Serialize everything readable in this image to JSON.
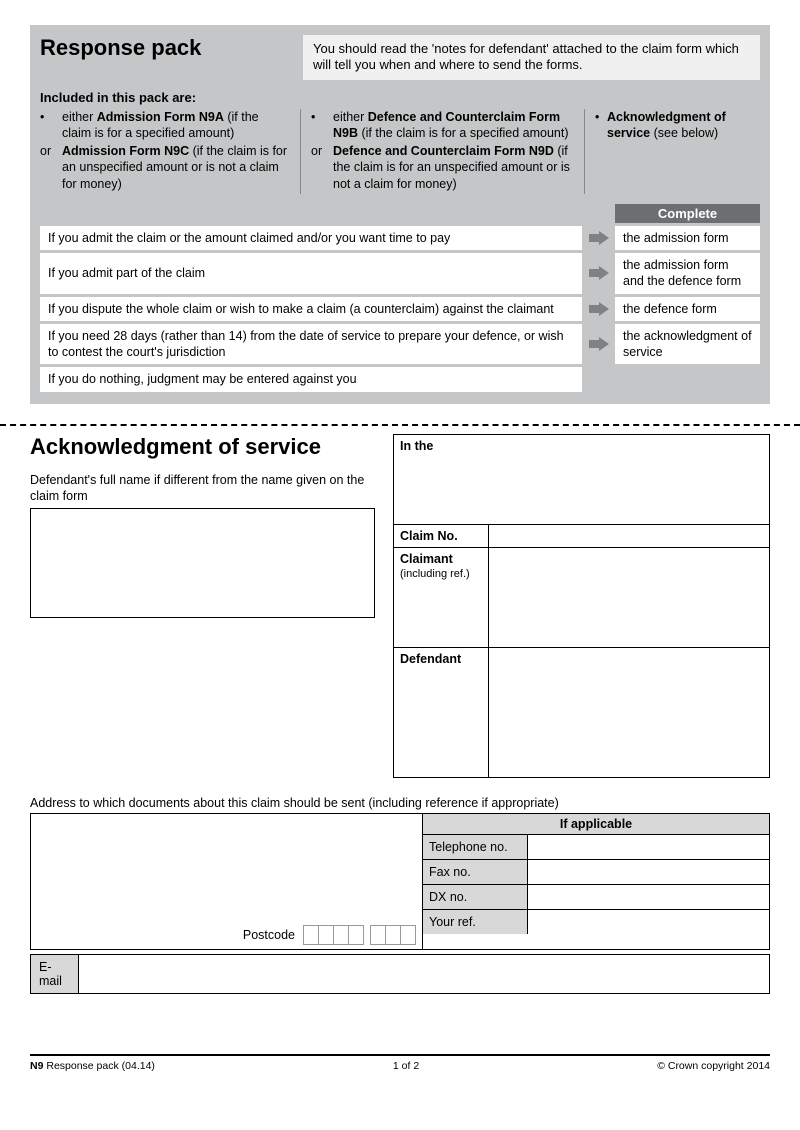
{
  "header": {
    "title": "Response pack",
    "notice": "You should read the 'notes for defendant' attached to the claim form which will tell you when and where to send the forms."
  },
  "included": {
    "heading": "Included in this pack are:",
    "col1": {
      "r1_bullet": "•",
      "r1_pre": "either ",
      "r1_bold": "Admission Form N9A",
      "r1_post": " (if the claim is for a specified amount)",
      "r2_bullet": "or",
      "r2_bold": "Admission Form N9C",
      "r2_post": " (if the claim is for an unspecified amount or is not a claim for money)"
    },
    "col2": {
      "r1_bullet": "•",
      "r1_pre": "either ",
      "r1_bold": "Defence and Counterclaim Form N9B",
      "r1_post": " (if the claim is for a specified amount)",
      "r2_bullet": "or",
      "r2_bold": "Defence and Counterclaim Form N9D",
      "r2_post": " (if the claim is for an unspecified amount or is not a claim for money)"
    },
    "col3": {
      "bullet": "•",
      "bold": "Acknowledgment of service",
      "post": " (see below)"
    }
  },
  "complete_label": "Complete",
  "rows": [
    {
      "left": "If you admit the claim or the amount claimed and/or you want time to pay",
      "right": "the admission form"
    },
    {
      "left": "If you admit part of the claim",
      "right": "the admission form and the defence form"
    },
    {
      "left": "If you dispute the whole claim or wish to make a claim (a counterclaim) against the claimant",
      "right": "the defence form"
    },
    {
      "left": "If you need 28 days (rather than 14) from the date of service to prepare your defence, or wish to contest the court's jurisdiction",
      "right": "the acknowledgment of service"
    }
  ],
  "nothing_row": "If you do nothing, judgment may be entered against you",
  "ack": {
    "title": "Acknowledgment of service",
    "name_note": "Defendant's full name if different from the name given on the claim form",
    "in_the": "In the",
    "claim_no": "Claim No",
    "claimant": "Claimant",
    "claimant_sub": "(including ref.)",
    "defendant": "Defendant"
  },
  "addr": {
    "note": "Address to which documents about this claim should be sent (including reference if appropriate)",
    "if_applicable": "If applicable",
    "tel": "Telephone no.",
    "fax": "Fax no.",
    "dx": "DX no.",
    "yourref": "Your ref.",
    "postcode": "Postcode",
    "email": "E-mail"
  },
  "footer": {
    "left_bold": "N9",
    "left_rest": " Response pack (04.14)",
    "page": "1 of 2",
    "right": "© Crown copyright 2014"
  }
}
